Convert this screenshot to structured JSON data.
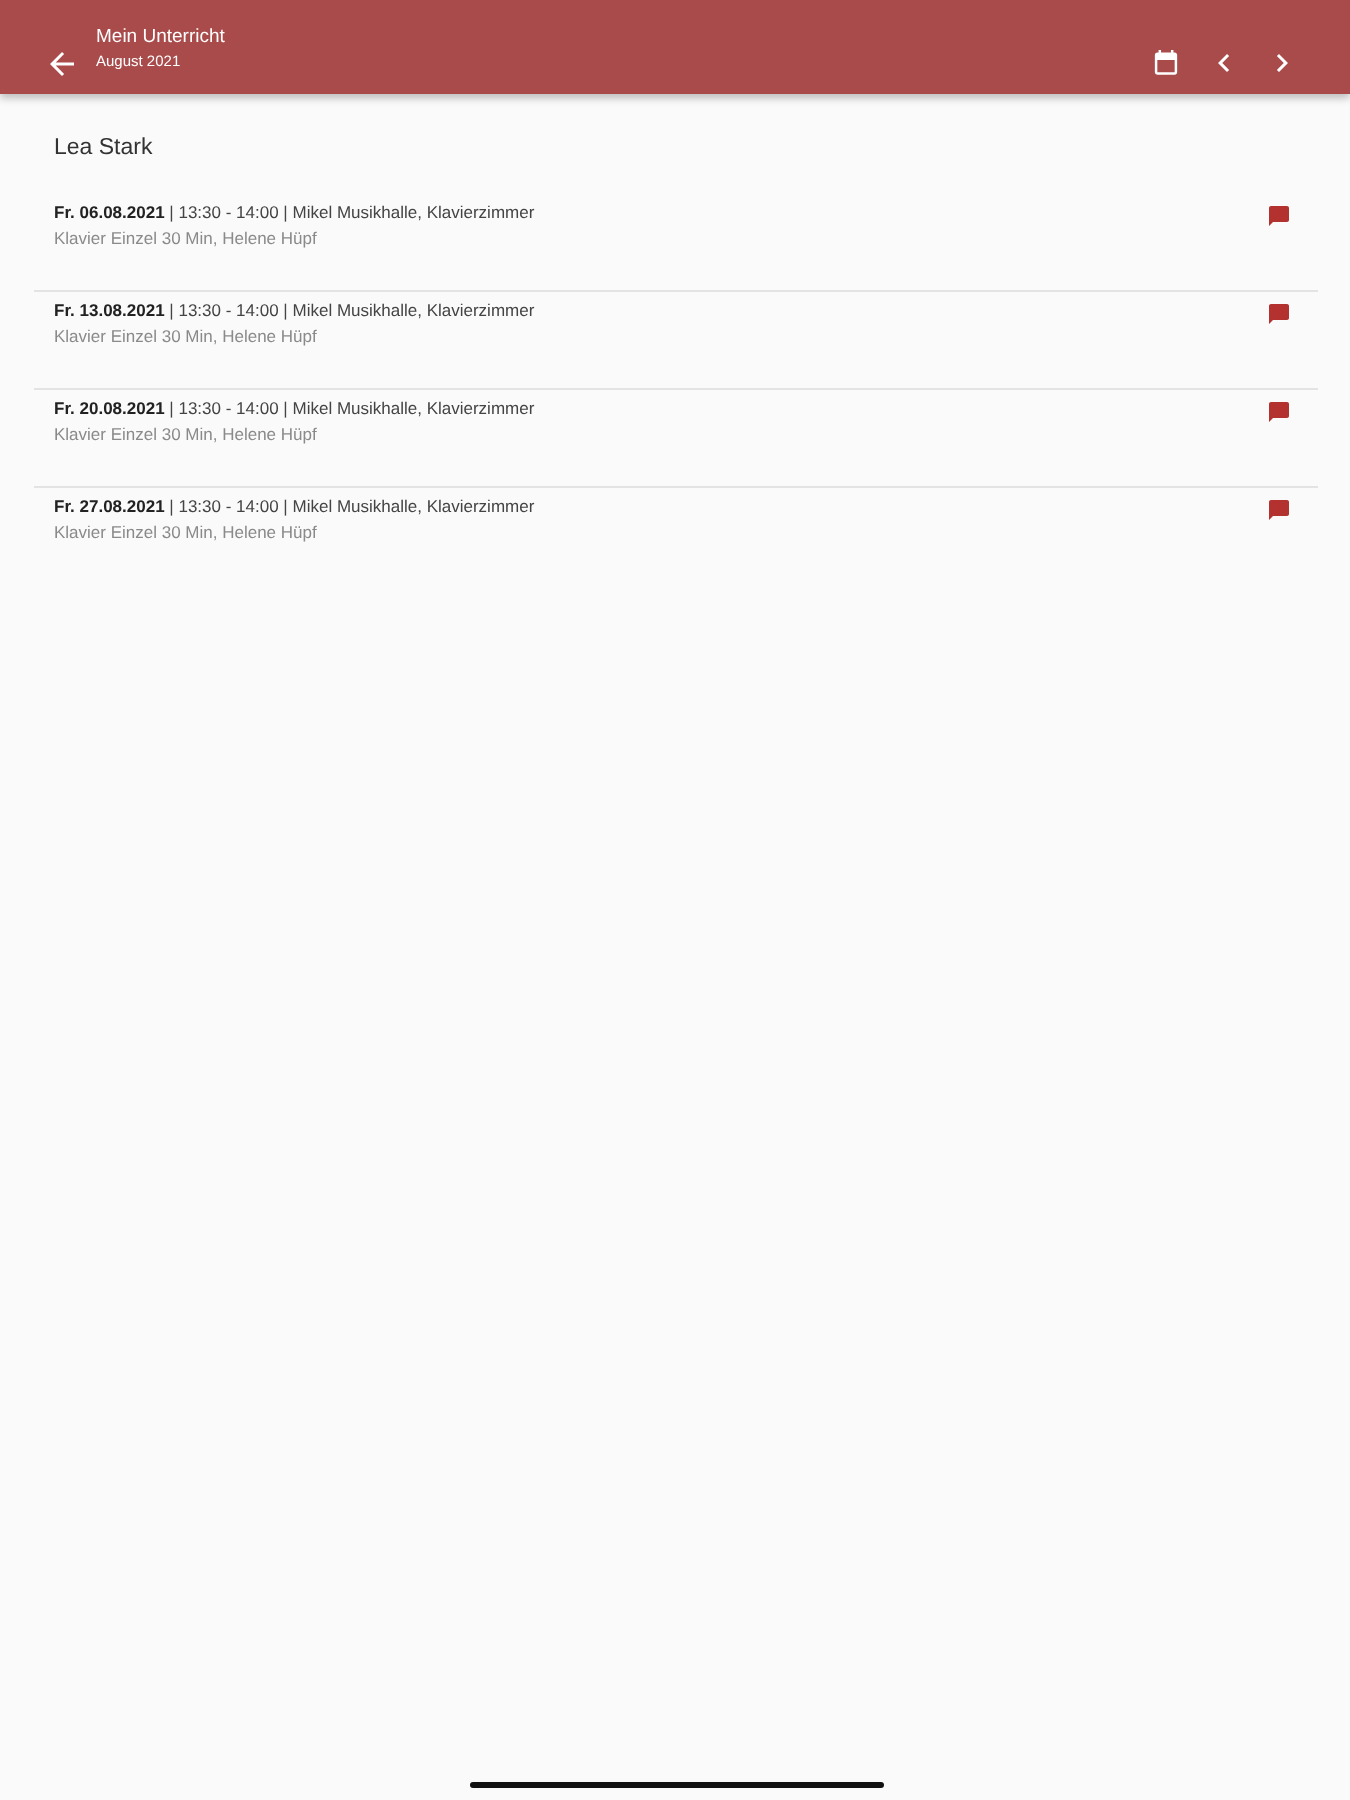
{
  "app_bar": {
    "title": "Mein Unterricht",
    "subtitle": "August 2021"
  },
  "student": {
    "name": "Lea Stark"
  },
  "lessons": [
    {
      "line_1": "**Fr. 06.08.2021** | 13:30 - 14:00 | Mikel Musikhalle, Klavierzimmer",
      "line_2": "Klavier Einzel 30 Min, Helene Hüpf"
    },
    {
      "line_1": "**Fr. 13.08.2021** | 13:30 - 14:00 | Mikel Musikhalle, Klavierzimmer",
      "line_2": "Klavier Einzel 30 Min, Helene Hüpf"
    },
    {
      "line_1": "**Fr. 20.08.2021** | 13:30 - 14:00 | Mikel Musikhalle, Klavierzimmer",
      "line_2": "Klavier Einzel 30 Min, Helene Hüpf"
    },
    {
      "line_1": "**Fr. 27.08.2021** | 13:30 - 14:00 | Mikel Musikhalle, Klavierzimmer",
      "line_2": "Klavier Einzel 30 Min, Helene Hüpf"
    }
  ]
}
